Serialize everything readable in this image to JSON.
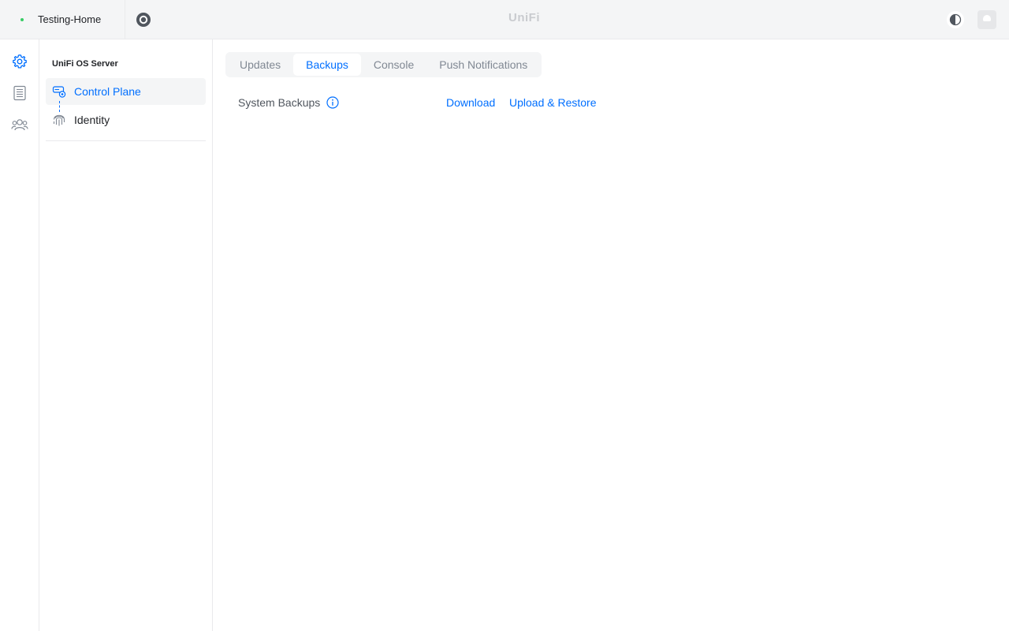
{
  "topbar": {
    "site_name": "Testing-Home",
    "brand": "UniFi",
    "status_color": "#38cc65",
    "icons": [
      "settings-ring-icon",
      "theme-toggle-icon",
      "avatar"
    ]
  },
  "rail": {
    "items": [
      {
        "name": "gear-icon",
        "active": true
      },
      {
        "name": "list-icon",
        "active": false
      },
      {
        "name": "users-icon",
        "active": false
      }
    ]
  },
  "sidebar": {
    "title": "UniFi OS Server",
    "items": [
      {
        "label": "Control Plane",
        "icon": "control-plane-icon",
        "active": true
      },
      {
        "label": "Identity",
        "icon": "fingerprint-icon",
        "active": false
      }
    ]
  },
  "main": {
    "tabs": [
      {
        "label": "Updates",
        "active": false
      },
      {
        "label": "Backups",
        "active": true
      },
      {
        "label": "Console",
        "active": false
      },
      {
        "label": "Push Notifications",
        "active": false
      }
    ],
    "backups": {
      "label": "System Backups",
      "download_label": "Download",
      "upload_label": "Upload & Restore"
    }
  },
  "colors": {
    "accent": "#006fff",
    "muted": "#808893",
    "background": "#f4f5f6"
  }
}
